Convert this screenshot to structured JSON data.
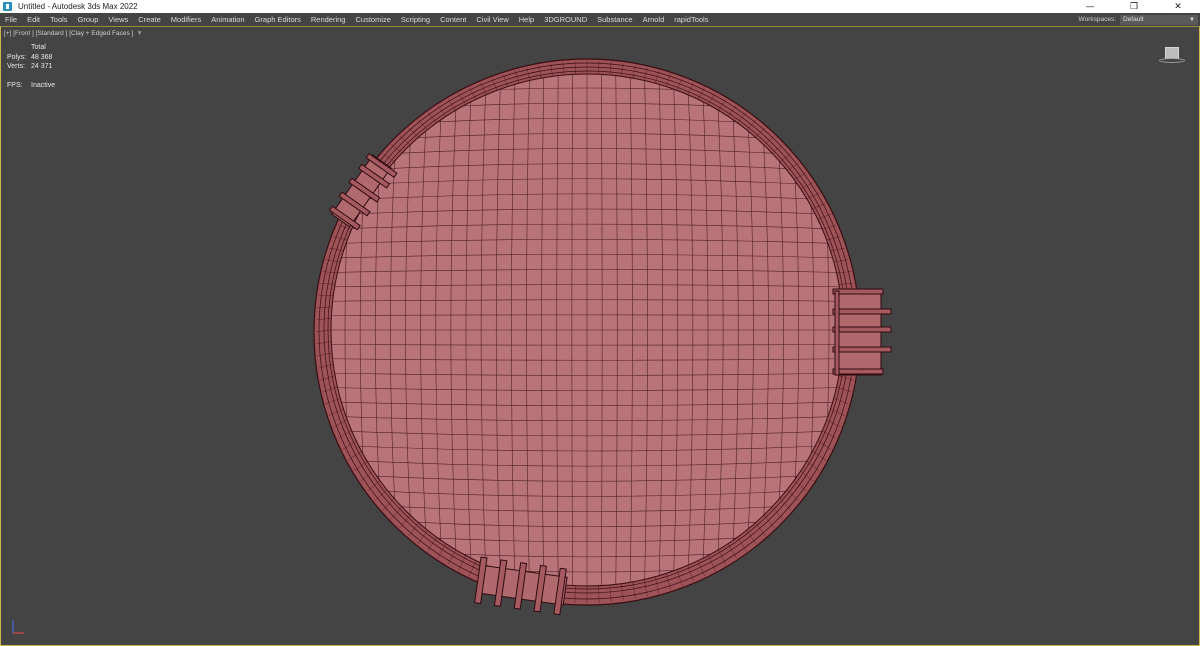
{
  "titlebar": {
    "title": "Untitled - Autodesk 3ds Max 2022",
    "minimize": "—",
    "maximize": "❐",
    "close": "✕"
  },
  "menu": [
    "File",
    "Edit",
    "Tools",
    "Group",
    "Views",
    "Create",
    "Modifiers",
    "Animation",
    "Graph Editors",
    "Rendering",
    "Customize",
    "Scripting",
    "Content",
    "Civil View",
    "Help",
    "3DGROUND",
    "Substance",
    "Arnold",
    "rapidTools"
  ],
  "workspaces": {
    "label": "Workspaces:",
    "value": "Default"
  },
  "viewport": {
    "label": "[+] [Front ] [Standard ] [Clay + Edged Faces ]",
    "stats": {
      "total_header": "Total",
      "polys_label": "Polys:",
      "polys_value": "48 368",
      "verts_label": "Verts:",
      "verts_value": "24 371",
      "fps_label": "FPS:",
      "fps_value": "Inactive"
    }
  },
  "colors": {
    "viewport_bg": "#444444",
    "mesh_fill": "#b06a6e",
    "mesh_wire": "#3a0d12",
    "viewport_border": "#c9b84a"
  },
  "icons": {
    "app": "3dsmax-icon",
    "viewcube": "viewcube-icon",
    "axis": "axis-gizmo-icon",
    "filter": "funnel-icon"
  }
}
